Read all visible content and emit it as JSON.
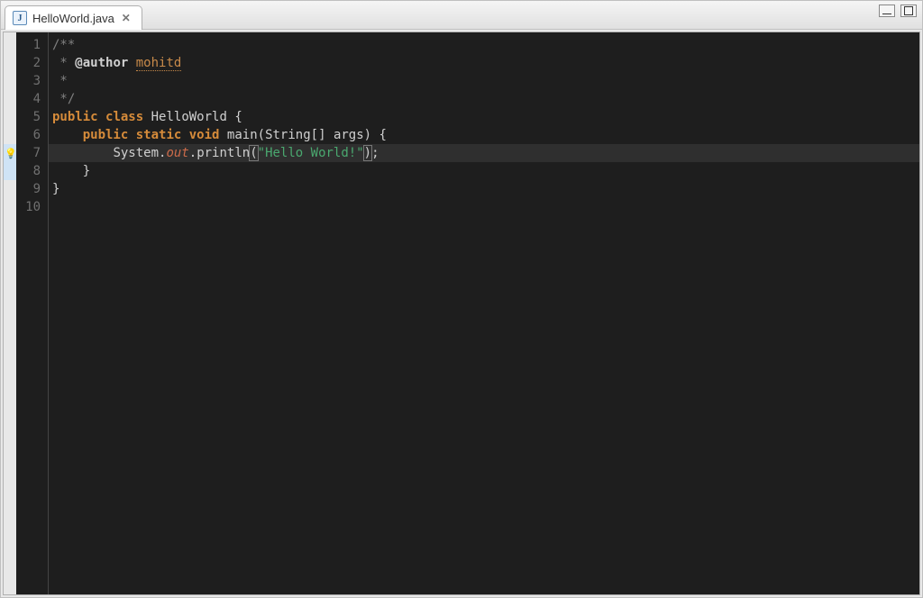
{
  "tab": {
    "icon_letter": "J",
    "filename": "HelloWorld.java",
    "close_glyph": "✕"
  },
  "lightbulb": {
    "glyph": "💡",
    "line": 7
  },
  "gutter": {
    "lines": [
      "1",
      "2",
      "3",
      "4",
      "5",
      "6",
      "7",
      "8",
      "9",
      "10"
    ],
    "fold_lines": [
      1,
      6
    ]
  },
  "code": {
    "l1": {
      "c": "/**"
    },
    "l2": {
      "prefix": " * ",
      "tag": "@author",
      "sp": " ",
      "author": "mohitd"
    },
    "l3": {
      "c": " *"
    },
    "l4": {
      "c": " */"
    },
    "l5": {
      "kw1": "public",
      "kw2": "class",
      "name": "HelloWorld",
      "brace": " {"
    },
    "l6": {
      "indent": "    ",
      "kw1": "public",
      "kw2": "static",
      "kw3": "void",
      "method": "main",
      "open": "(",
      "type": "String",
      "arr": "[] ",
      "arg": "args",
      "close": ")",
      "brace": " {"
    },
    "l7": {
      "indent": "        ",
      "obj": "System",
      "dot1": ".",
      "field": "out",
      "dot2": ".",
      "call": "println",
      "open": "(",
      "str": "\"Hello World!\"",
      "close": ")",
      "semi": ";"
    },
    "l8": {
      "indent": "    ",
      "brace": "}"
    },
    "l9": {
      "brace": "}"
    }
  }
}
